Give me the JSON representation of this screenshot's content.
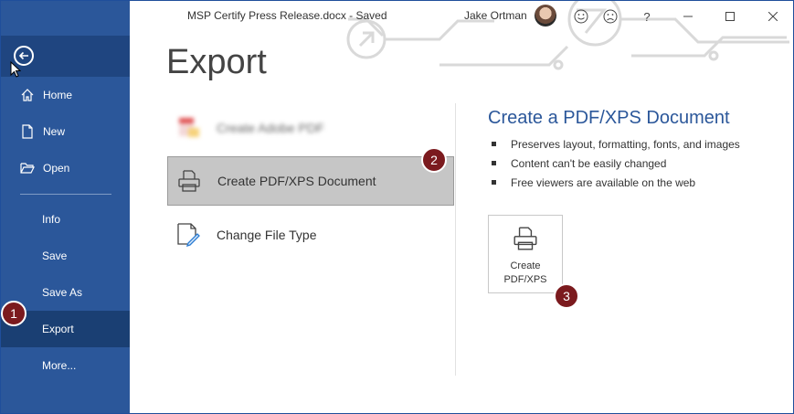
{
  "window": {
    "doc_title": "MSP Certify Press Release.docx  -  Saved",
    "user_name": "Jake Ortman",
    "help_label": "?"
  },
  "sidebar": {
    "items": [
      {
        "label": "Home",
        "icon": "home-icon"
      },
      {
        "label": "New",
        "icon": "new-document-icon"
      },
      {
        "label": "Open",
        "icon": "open-folder-icon"
      },
      {
        "label": "Info"
      },
      {
        "label": "Save"
      },
      {
        "label": "Save As"
      },
      {
        "label": "Export",
        "active": true
      },
      {
        "label": "More..."
      }
    ]
  },
  "main": {
    "title": "Export",
    "options": [
      {
        "label": "Create Adobe PDF",
        "icon": "adobe-pdf-icon",
        "blurred": true
      },
      {
        "label": "Create PDF/XPS Document",
        "icon": "pdf-xps-icon",
        "selected": true
      },
      {
        "label": "Change File Type",
        "icon": "change-file-type-icon"
      }
    ]
  },
  "detail": {
    "title": "Create a PDF/XPS Document",
    "bullets": [
      "Preserves layout, formatting, fonts, and images",
      "Content can't be easily changed",
      "Free viewers are available on the web"
    ],
    "button_line1": "Create",
    "button_line2": "PDF/XPS"
  },
  "badges": [
    "1",
    "2",
    "3"
  ],
  "colors": {
    "sidebar": "#2b579a",
    "sidebar_active": "#1a3f73",
    "accent_text": "#2b579a",
    "badge": "#7b1a1e",
    "selected_option": "#c6c6c6"
  }
}
